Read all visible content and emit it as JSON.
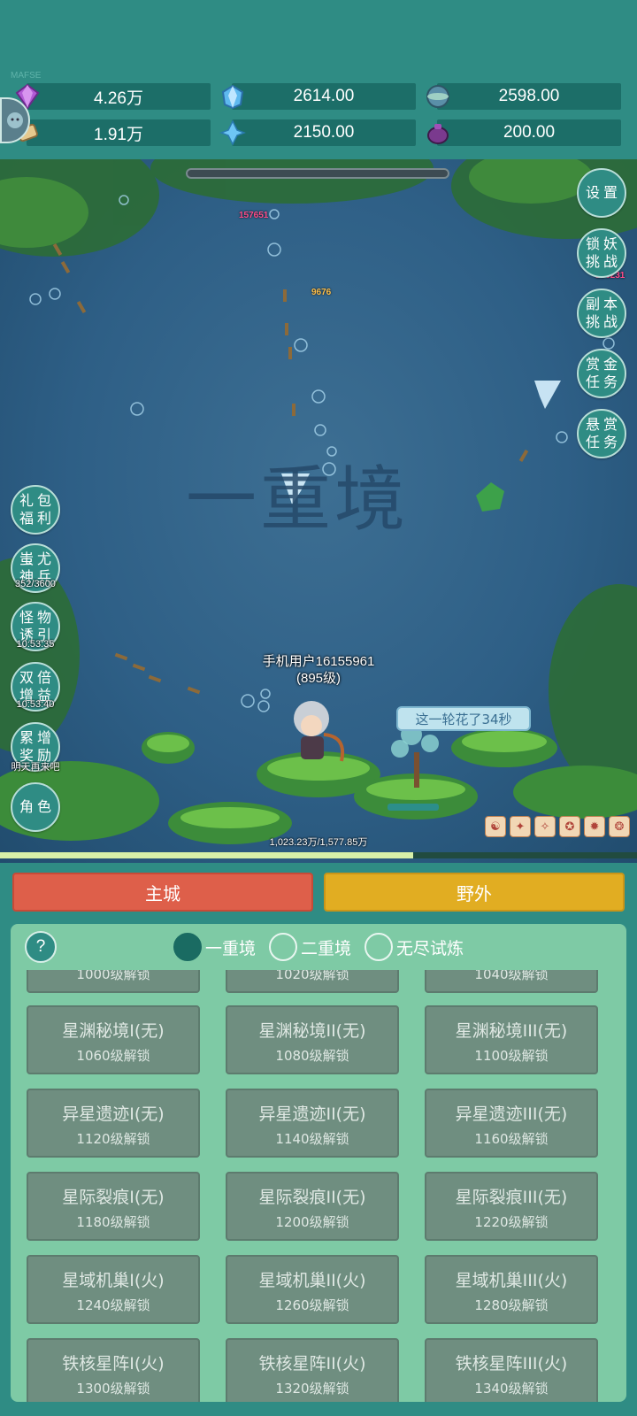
{
  "top_bar": {
    "tag": "MAFSE",
    "resources": [
      {
        "icon": "purple-gem-icon",
        "value": "4.26万"
      },
      {
        "icon": "blue-crystal-icon",
        "value": "2614.00"
      },
      {
        "icon": "globe-orb-icon",
        "value": "2598.00"
      },
      {
        "icon": "scroll-icon",
        "value": "1.91万"
      },
      {
        "icon": "ice-shard-icon",
        "value": "2150.00"
      },
      {
        "icon": "purple-pouch-icon",
        "value": "200.00"
      }
    ]
  },
  "right_buttons": [
    {
      "label": "设置"
    },
    {
      "label": "锁妖挑战"
    },
    {
      "label": "副本挑战"
    },
    {
      "label": "赏金任务"
    },
    {
      "label": "悬赏任务"
    }
  ],
  "left_buttons": [
    {
      "label": "礼包福利",
      "sub": ""
    },
    {
      "label": "蚩尤神兵",
      "sub": "352/3600"
    },
    {
      "label": "怪物诱引",
      "sub": "10:53:35"
    },
    {
      "label": "双倍增益",
      "sub": "10:53:40"
    },
    {
      "label": "累增奖励",
      "sub": "明天再来吧"
    },
    {
      "label": "角色",
      "sub": ""
    }
  ],
  "scene": {
    "damage_1": "157651",
    "damage_2": "9676",
    "damage_3": "166231",
    "realm_watermark": "一重境",
    "player_name": "手机用户16155961",
    "player_level": "(895级)",
    "round_time": "这一轮花了34秒",
    "xp_text": "1,023.23万/1,577.85万",
    "xp_progress": 0.648
  },
  "bottom": {
    "tab_city": "主城",
    "tab_wild": "野外",
    "help": "?",
    "modes": [
      "一重境",
      "二重境",
      "无尽试炼"
    ],
    "selected_mode": 0,
    "cards": [
      {
        "name": "",
        "req": "1000级解锁"
      },
      {
        "name": "",
        "req": "1020级解锁"
      },
      {
        "name": "",
        "req": "1040级解锁"
      },
      {
        "name": "星渊秘境I(无)",
        "req": "1060级解锁"
      },
      {
        "name": "星渊秘境II(无)",
        "req": "1080级解锁"
      },
      {
        "name": "星渊秘境III(无)",
        "req": "1100级解锁"
      },
      {
        "name": "异星遗迹I(无)",
        "req": "1120级解锁"
      },
      {
        "name": "异星遗迹II(无)",
        "req": "1140级解锁"
      },
      {
        "name": "异星遗迹III(无)",
        "req": "1160级解锁"
      },
      {
        "name": "星际裂痕I(无)",
        "req": "1180级解锁"
      },
      {
        "name": "星际裂痕II(无)",
        "req": "1200级解锁"
      },
      {
        "name": "星际裂痕III(无)",
        "req": "1220级解锁"
      },
      {
        "name": "星域机巢I(火)",
        "req": "1240级解锁"
      },
      {
        "name": "星域机巢II(火)",
        "req": "1260级解锁"
      },
      {
        "name": "星域机巢III(火)",
        "req": "1280级解锁"
      },
      {
        "name": "铁核星阵I(火)",
        "req": "1300级解锁"
      },
      {
        "name": "铁核星阵II(火)",
        "req": "1320级解锁"
      },
      {
        "name": "铁核星阵III(火)",
        "req": "1340级解锁"
      }
    ]
  },
  "colors": {
    "panel": "#2f8c84",
    "city_tab": "#de5f4a",
    "wild_tab": "#e1ad22",
    "card": "#6f8e80"
  }
}
